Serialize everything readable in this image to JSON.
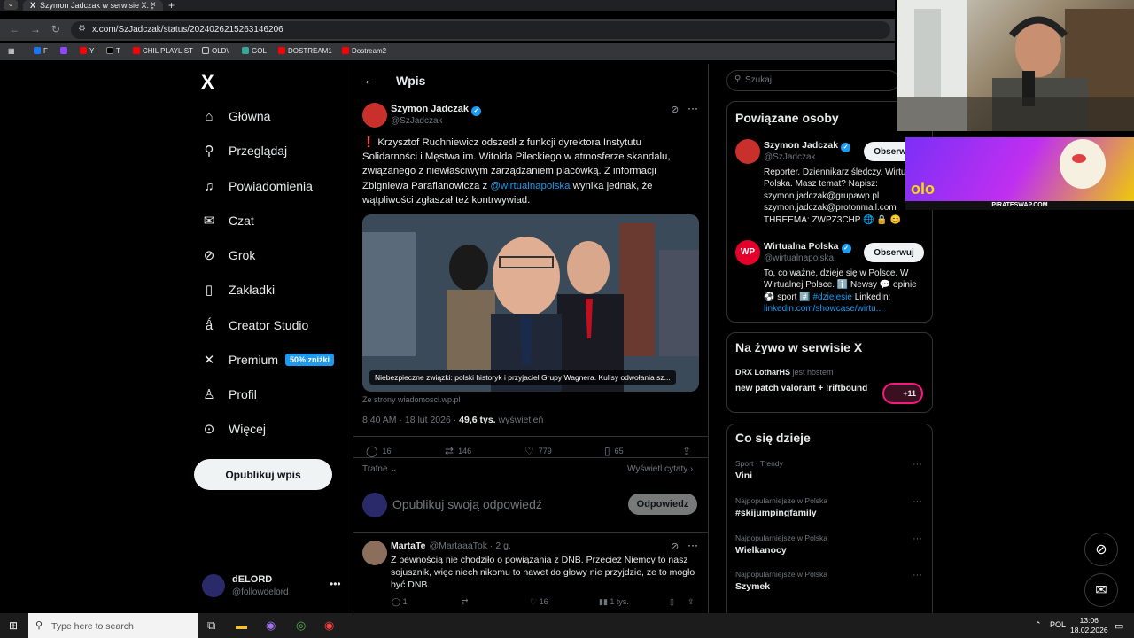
{
  "browser": {
    "tab_title": "Szymon Jadczak w serwisie X: „",
    "tab_icon": "X",
    "url": "x.com/SzJadczak/status/2024026215263146206",
    "bookmarks": [
      "F",
      "Y",
      "T",
      "CHIL PLAYLIST",
      "OLD\\",
      "GOL",
      "DOSTREAM1",
      "Dostream2"
    ]
  },
  "nav": {
    "logo": "X",
    "items": [
      {
        "label": "Główna",
        "icon": "home-icon"
      },
      {
        "label": "Przeglądaj",
        "icon": "search-icon"
      },
      {
        "label": "Powiadomienia",
        "icon": "bell-icon"
      },
      {
        "label": "Czat",
        "icon": "mail-icon"
      },
      {
        "label": "Grok",
        "icon": "grok-icon"
      },
      {
        "label": "Zakładki",
        "icon": "bookmark-icon"
      },
      {
        "label": "Creator Studio",
        "icon": "creator-icon"
      },
      {
        "label": "Premium",
        "icon": "x-icon"
      },
      {
        "label": "Profil",
        "icon": "profile-icon"
      },
      {
        "label": "Więcej",
        "icon": "more-icon"
      }
    ],
    "premium_badge": "50% zniżki",
    "post_button": "Opublikuj wpis",
    "user": {
      "name": "dELORD",
      "handle": "@followdelord"
    }
  },
  "header": {
    "title": "Wpis"
  },
  "post": {
    "author": "Szymon Jadczak",
    "handle": "@SzJadczak",
    "text_excl": "❗",
    "text_1": "Krzysztof Ruchniewicz odszedł z funkcji dyrektora Instytutu Solidarności i Męstwa im. Witolda Pileckiego w atmosferze skandalu, związanego z niewłaściwym zarządzaniem placówką. Z informacji Zbigniewa Parafianowicza z ",
    "mention": "@wirtualnapolska",
    "text_2": " wynika jednak, że wątpliwości zgłaszał też kontrwywiad.",
    "card_caption": "Niebezpieczne związki: polski historyk i przyjaciel Grupy Wagnera. Kulisy odwołania sz...",
    "card_source": "Ze strony wiadomosci.wp.pl",
    "time": "8:40 AM · 18 lut 2026 · ",
    "views": "49,6 tys.",
    "views_label": " wyświetleń",
    "stats": {
      "replies": "16",
      "reposts": "146",
      "likes": "779",
      "bookmarks": "65"
    },
    "sort": "Trafne",
    "view_quotes": "Wyświetl cytaty"
  },
  "reply": {
    "placeholder": "Opublikuj swoją odpowiedź",
    "button": "Odpowiedz"
  },
  "comment": {
    "author": "MartaTe",
    "meta": "@MartaaaTok · 2 g.",
    "text": "Z pewnością nie chodziło o powiązania z DNB. Przecież Niemcy to nasz sojusznik, więc niech nikomu to nawet do głowy nie przyjdzie, że to mogło być DNB.",
    "stats": {
      "replies": "1",
      "likes": "16",
      "views": "1 tys."
    }
  },
  "sidebar": {
    "search_placeholder": "Szukaj",
    "related_title": "Powiązane osoby",
    "related": [
      {
        "name": "Szymon Jadczak",
        "handle": "@SzJadczak",
        "button": "Obserwuj",
        "bio": "Reporter. Dziennikarz śledczy. Wirtualna Polska. Masz temat? Napisz: szymon.jadczak@grupawp.pl szymon.jadczak@protonmail.com THREEMA: ZWPZ3CHP 🌐 🔒 😊"
      },
      {
        "name": "Wirtualna Polska",
        "handle": "@wirtualnapolska",
        "button": "Obserwuj",
        "bio_1": "To, co ważne, dzieje się w Polsce. W Wirtualnej Polsce. ℹ️ Newsy 💬 opinie ⚽ sport #️⃣ ",
        "bio_tag": "#dziejesie",
        "bio_2": " LinkedIn: ",
        "bio_link": "linkedin.com/showcase/wirtu..."
      }
    ],
    "live_title": "Na żywo w serwisie X",
    "live": {
      "host": "DRX LotharHS",
      "host_label": "jest hostem",
      "title": "new patch valorant + !riftbound",
      "count": "+11"
    },
    "trends_title": "Co się dzieje",
    "trends": [
      {
        "context": "Sport · Trendy",
        "name": "Vini"
      },
      {
        "context": "Najpopularniejsze w Polska",
        "name": "#skijumpingfamily"
      },
      {
        "context": "Najpopularniejsze w Polska",
        "name": "Wielkanocy"
      },
      {
        "context": "Najpopularniejsze w Polska",
        "name": "Szymek"
      }
    ]
  },
  "overlay": {
    "promo": "PIRATESWAP.COM"
  },
  "taskbar": {
    "search_placeholder": "Type here to search",
    "lang": "POL",
    "time": "13:06",
    "date": "18.02.2026"
  }
}
